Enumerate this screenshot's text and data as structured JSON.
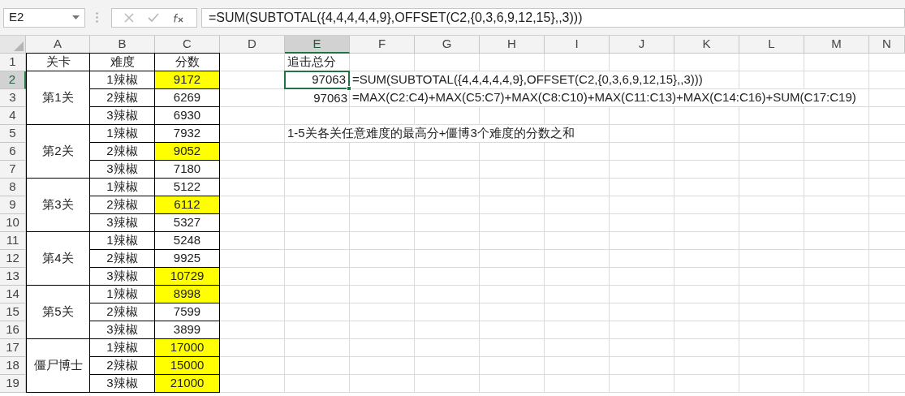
{
  "formula_bar": {
    "name_box": "E2",
    "formula": "=SUM(SUBTOTAL({4,4,4,4,4,9},OFFSET(C2,{0,3,6,9,12,15},,3)))"
  },
  "columns": [
    {
      "label": "A",
      "selected": false
    },
    {
      "label": "B",
      "selected": false
    },
    {
      "label": "C",
      "selected": false
    },
    {
      "label": "D",
      "selected": false
    },
    {
      "label": "E",
      "selected": true
    },
    {
      "label": "F",
      "selected": false
    },
    {
      "label": "G",
      "selected": false
    },
    {
      "label": "H",
      "selected": false
    },
    {
      "label": "I",
      "selected": false
    },
    {
      "label": "J",
      "selected": false
    },
    {
      "label": "K",
      "selected": false
    },
    {
      "label": "L",
      "selected": false
    },
    {
      "label": "M",
      "selected": false
    },
    {
      "label": "N",
      "selected": false
    }
  ],
  "rows": [
    {
      "label": "1",
      "selected": false
    },
    {
      "label": "2",
      "selected": true
    },
    {
      "label": "3",
      "selected": false
    },
    {
      "label": "4",
      "selected": false
    },
    {
      "label": "5",
      "selected": false
    },
    {
      "label": "6",
      "selected": false
    },
    {
      "label": "7",
      "selected": false
    },
    {
      "label": "8",
      "selected": false
    },
    {
      "label": "9",
      "selected": false
    },
    {
      "label": "10",
      "selected": false
    },
    {
      "label": "11",
      "selected": false
    },
    {
      "label": "12",
      "selected": false
    },
    {
      "label": "13",
      "selected": false
    },
    {
      "label": "14",
      "selected": false
    },
    {
      "label": "15",
      "selected": false
    },
    {
      "label": "16",
      "selected": false
    },
    {
      "label": "17",
      "selected": false
    },
    {
      "label": "18",
      "selected": false
    },
    {
      "label": "19",
      "selected": false
    }
  ],
  "table": {
    "headers": [
      "关卡",
      "难度",
      "分数"
    ],
    "groups": [
      {
        "stage": "第1关",
        "entries": [
          {
            "difficulty": "1辣椒",
            "score": "9172",
            "highlighted": true
          },
          {
            "difficulty": "2辣椒",
            "score": "6269",
            "highlighted": false
          },
          {
            "difficulty": "3辣椒",
            "score": "6930",
            "highlighted": false
          }
        ]
      },
      {
        "stage": "第2关",
        "entries": [
          {
            "difficulty": "1辣椒",
            "score": "7932",
            "highlighted": false
          },
          {
            "difficulty": "2辣椒",
            "score": "9052",
            "highlighted": true
          },
          {
            "difficulty": "3辣椒",
            "score": "7180",
            "highlighted": false
          }
        ]
      },
      {
        "stage": "第3关",
        "entries": [
          {
            "difficulty": "1辣椒",
            "score": "5122",
            "highlighted": false
          },
          {
            "difficulty": "2辣椒",
            "score": "6112",
            "highlighted": true
          },
          {
            "difficulty": "3辣椒",
            "score": "5327",
            "highlighted": false
          }
        ]
      },
      {
        "stage": "第4关",
        "entries": [
          {
            "difficulty": "1辣椒",
            "score": "5248",
            "highlighted": false
          },
          {
            "difficulty": "2辣椒",
            "score": "9925",
            "highlighted": false
          },
          {
            "difficulty": "3辣椒",
            "score": "10729",
            "highlighted": true
          }
        ]
      },
      {
        "stage": "第5关",
        "entries": [
          {
            "difficulty": "1辣椒",
            "score": "8998",
            "highlighted": true
          },
          {
            "difficulty": "2辣椒",
            "score": "7599",
            "highlighted": false
          },
          {
            "difficulty": "3辣椒",
            "score": "3899",
            "highlighted": false
          }
        ]
      },
      {
        "stage": "僵尸博士",
        "entries": [
          {
            "difficulty": "1辣椒",
            "score": "17000",
            "highlighted": true
          },
          {
            "difficulty": "2辣椒",
            "score": "15000",
            "highlighted": true
          },
          {
            "difficulty": "3辣椒",
            "score": "21000",
            "highlighted": true
          }
        ]
      }
    ]
  },
  "side_cells": {
    "E1": {
      "kind": "text",
      "text": "追击总分"
    },
    "E2": {
      "kind": "number",
      "text": "97063",
      "active": true
    },
    "F2": {
      "kind": "text",
      "text": "=SUM(SUBTOTAL({4,4,4,4,4,9},OFFSET(C2,{0,3,6,9,12,15},,3)))"
    },
    "E3": {
      "kind": "number",
      "text": "97063",
      "active": false
    },
    "F3": {
      "kind": "text",
      "text": "=MAX(C2:C4)+MAX(C5:C7)+MAX(C8:C10)+MAX(C11:C13)+MAX(C14:C16)+SUM(C17:C19)"
    },
    "E5": {
      "kind": "text",
      "text": "1-5关各关任意难度的最高分+僵博3个难度的分数之和"
    }
  }
}
